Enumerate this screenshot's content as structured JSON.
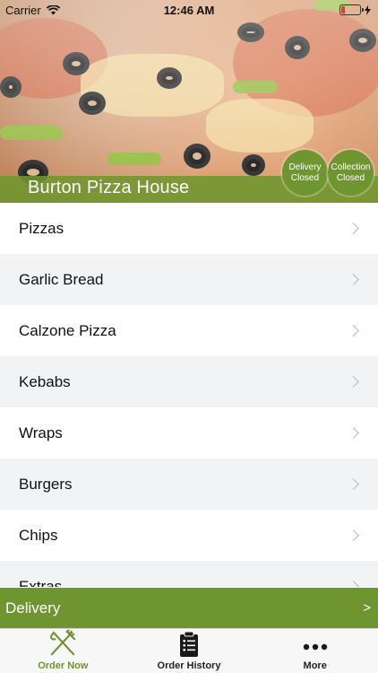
{
  "status_bar": {
    "carrier": "Carrier",
    "time": "12:46 AM"
  },
  "header": {
    "restaurant_name": "Burton Pizza House",
    "delivery_status": [
      "Delivery",
      "Closed"
    ],
    "collection_status": [
      "Collection",
      "Closed"
    ]
  },
  "menu": {
    "categories": [
      "Pizzas",
      "Garlic Bread",
      "Calzone Pizza",
      "Kebabs",
      "Wraps",
      "Burgers",
      "Chips",
      "Extras"
    ]
  },
  "order_bar": {
    "mode": "Delivery",
    "arrow": ">"
  },
  "tabs": [
    {
      "label": "Order Now",
      "icon": "fork-knife-icon"
    },
    {
      "label": "Order History",
      "icon": "clipboard-list-icon"
    },
    {
      "label": "More",
      "icon": "more-dots-icon"
    }
  ],
  "colors": {
    "accent": "#6f9530",
    "battery_low": "#e53935"
  }
}
